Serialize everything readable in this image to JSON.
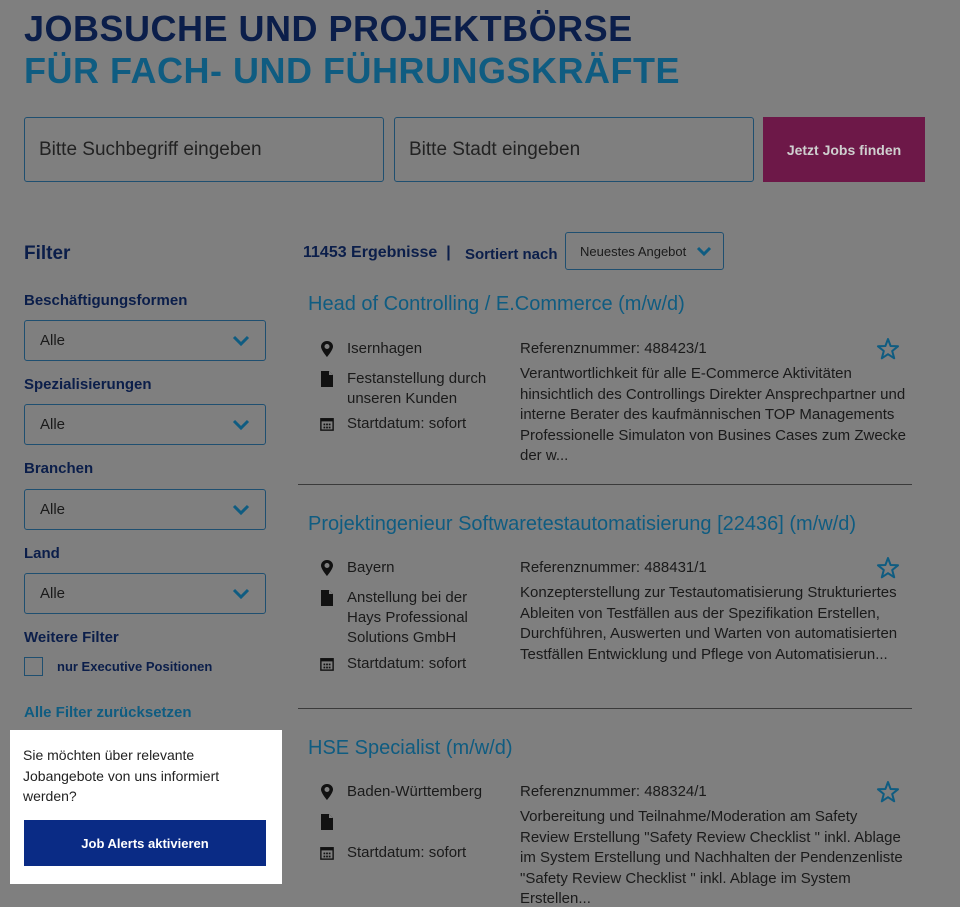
{
  "header": {
    "title_line1": "JOBSUCHE UND PROJEKTBÖRSE",
    "title_line2": "FÜR FACH- UND FÜHRUNGSKRÄFTE"
  },
  "search": {
    "keyword_placeholder": "Bitte Suchbegriff eingeben",
    "city_placeholder": "Bitte Stadt eingeben",
    "button_label": "Jetzt Jobs finden"
  },
  "filter": {
    "title": "Filter",
    "groups": [
      {
        "label": "Beschäftigungsformen",
        "value": "Alle"
      },
      {
        "label": "Spezialisierungen",
        "value": "Alle"
      },
      {
        "label": "Branchen",
        "value": "Alle"
      },
      {
        "label": "Land",
        "value": "Alle"
      }
    ],
    "more_label": "Weitere Filter",
    "executive_label": "nur Executive Positionen",
    "reset_label": "Alle Filter zurücksetzen"
  },
  "alert": {
    "text": "Sie möchten über relevante Jobangebote von uns informiert werden?",
    "button_label": "Job Alerts aktivieren"
  },
  "results": {
    "count_text": "11453 Ergebnisse",
    "separator": "|",
    "sort_label": "Sortiert nach",
    "sort_value": "Neuestes Angebot"
  },
  "jobs": [
    {
      "title": "Head of Controlling / E.Commerce (m/w/d)",
      "location": "Isernhagen",
      "employment": "Festanstellung durch unseren Kunden",
      "start": "Startdatum: sofort",
      "reference": "Referenznummer: 488423/1",
      "description": "Verantwortlichkeit für alle E-Commerce Aktivitäten hinsichtlich des Controllings Direkter Ansprechpartner und interne Berater des kaufmännischen TOP Managements Professionelle Simulaton von Busines Cases zum Zwecke der w..."
    },
    {
      "title": "Projektingenieur Softwaretestautomatisierung [22436] (m/w/d)",
      "location": "Bayern",
      "employment": "Anstellung bei der Hays Professional Solutions GmbH",
      "start": "Startdatum: sofort",
      "reference": "Referenznummer: 488431/1",
      "description": "Konzepterstellung zur Testautomatisierung Strukturiertes Ableiten von Testfällen aus der Spezifikation Erstellen, Durchführen, Auswerten und Warten von automatisierten Testfällen Entwicklung und Pflege von Automatisierun..."
    },
    {
      "title": "HSE Specialist (m/w/d)",
      "location": "Baden-Württemberg",
      "employment": "",
      "start": "Startdatum: sofort",
      "reference": "Referenznummer: 488324/1",
      "description": "Vorbereitung und Teilnahme/Moderation am Safety Review Erstellung \"Safety Review Checklist \" inkl. Ablage im System Erstellung und Nachhalten der Pendenzenliste \"Safety Review Checklist \" inkl. Ablage im System Erstellen..."
    }
  ]
}
